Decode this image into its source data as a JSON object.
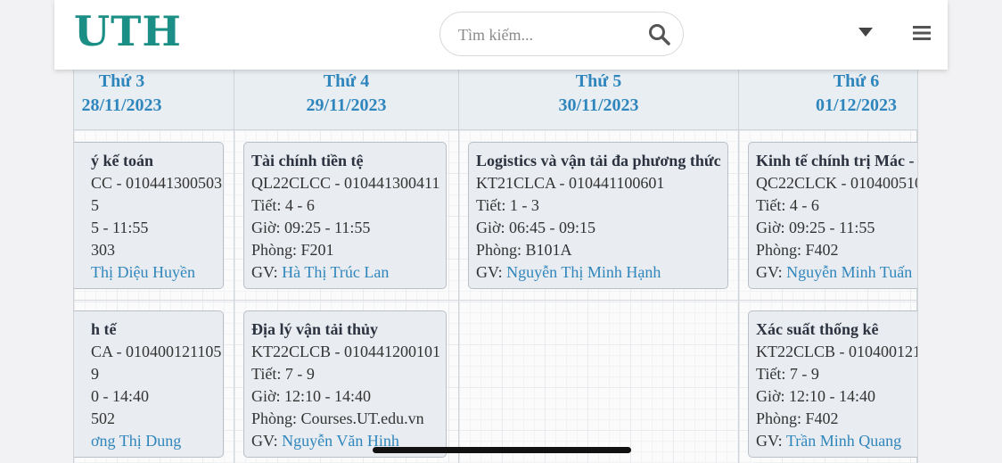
{
  "header": {
    "logo": "UTH",
    "search_placeholder": "Tìm kiếm..."
  },
  "icons": {
    "search": "search-icon",
    "dropdown": "caret-down-icon",
    "menu": "hamburger-menu-icon"
  },
  "days": [
    {
      "name": "Thứ 3",
      "date": "28/11/2023"
    },
    {
      "name": "Thứ 4",
      "date": "29/11/2023"
    },
    {
      "name": "Thứ 5",
      "date": "30/11/2023"
    },
    {
      "name": "Thứ 6",
      "date": "01/12/2023"
    }
  ],
  "classes": [
    {
      "title": "ý kế toán",
      "code": "CC - 010441300503",
      "periods": "5",
      "time": "5 - 11:55",
      "room": "303",
      "teacher_prefix": "",
      "teacher": "Thị Diệu Huyền"
    },
    {
      "title": "Tài chính tiền tệ",
      "code": "QL22CLCC - 010441300411",
      "periods": "Tiết: 4 - 6",
      "time": "Giờ: 09:25 - 11:55",
      "room": "Phòng: F201",
      "teacher_prefix": "GV: ",
      "teacher": "Hà Thị Trúc Lan"
    },
    {
      "title": "Logistics và vận tải đa phương thức",
      "code": "KT21CLCA - 010441100601",
      "periods": "Tiết: 1 - 3",
      "time": "Giờ: 06:45 - 09:15",
      "room": "Phòng: B101A",
      "teacher_prefix": "GV: ",
      "teacher": "Nguyễn Thị Minh Hạnh"
    },
    {
      "title": "Kinh tế chính trị Mác -",
      "code": "QC22CLCK - 010400510",
      "periods": "Tiết: 4 - 6",
      "time": "Giờ: 09:25 - 11:55",
      "room": "Phòng: F402",
      "teacher_prefix": "GV: ",
      "teacher": "Nguyễn Minh Tuấn"
    },
    {
      "title": "h tế",
      "code": "CA - 010400121105",
      "periods": "9",
      "time": "0 - 14:40",
      "room": "502",
      "teacher_prefix": "",
      "teacher": "ơng Thị Dung"
    },
    {
      "title": "Địa lý vận tải thủy",
      "code": "KT22CLCB - 010441200101",
      "periods": "Tiết: 7 - 9",
      "time": "Giờ: 12:10 - 14:40",
      "room": "Phòng: Courses.UT.edu.vn",
      "teacher_prefix": "GV: ",
      "teacher": "Nguyễn Văn Hinh"
    },
    {
      "title": "Xác suất thống kê",
      "code": "KT22CLCB - 010400121",
      "periods": "Tiết: 7 - 9",
      "time": "Giờ: 12:10 - 14:40",
      "room": "Phòng: F402",
      "teacher_prefix": "GV: ",
      "teacher": "Trần Minh Quang"
    }
  ]
}
